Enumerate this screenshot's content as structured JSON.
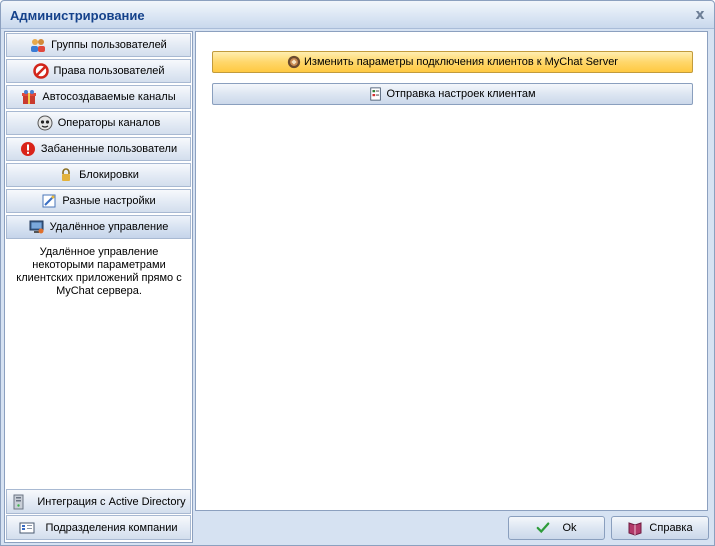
{
  "window": {
    "title": "Администрирование",
    "close_glyph": "x"
  },
  "nav": {
    "items": [
      {
        "label": "Группы пользователей",
        "icon": "users-group-icon"
      },
      {
        "label": "Права пользователей",
        "icon": "forbidden-icon"
      },
      {
        "label": "Автосоздаваемые каналы",
        "icon": "gift-icon"
      },
      {
        "label": "Операторы каналов",
        "icon": "operator-icon"
      },
      {
        "label": "Забаненные пользователи",
        "icon": "alert-icon"
      },
      {
        "label": "Блокировки",
        "icon": "lock-icon"
      },
      {
        "label": "Разные настройки",
        "icon": "settings-icon"
      },
      {
        "label": "Удалённое управление",
        "icon": "remote-monitor-icon"
      }
    ],
    "active_index": 7,
    "description": "Удалённое управление некоторыми параметрами клиентских приложений прямо с MyChat сервера.",
    "bottom_items": [
      {
        "label": "Интеграция с Active Directory",
        "icon": "server-icon"
      },
      {
        "label": "Подразделения компании",
        "icon": "company-icon"
      }
    ]
  },
  "content": {
    "actions": [
      {
        "label": "Изменить параметры подключения клиентов к MyChat Server",
        "icon": "connection-icon"
      },
      {
        "label": "Отправка настроек клиентам",
        "icon": "send-settings-icon"
      }
    ]
  },
  "footer": {
    "ok_label": "Ok",
    "help_label": "Справка"
  },
  "colors": {
    "title_text": "#15428b",
    "window_bg": "#d6e2f2",
    "highlight_button": "#ffd76b"
  }
}
